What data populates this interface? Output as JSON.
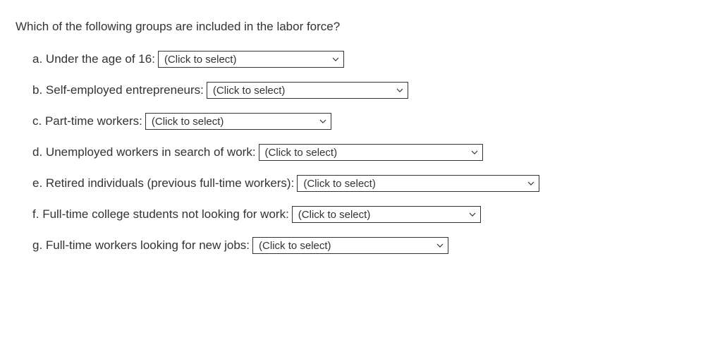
{
  "question": "Which of the following groups are included in the labor force?",
  "placeholder": "(Click to select)",
  "options": {
    "a": {
      "letter": "a.",
      "text": "Under the age of 16:"
    },
    "b": {
      "letter": "b.",
      "text": "Self-employed entrepreneurs:"
    },
    "c": {
      "letter": "c.",
      "text": "Part-time workers:"
    },
    "d": {
      "letter": "d.",
      "text": "Unemployed workers in search of work:"
    },
    "e": {
      "letter": "e.",
      "text": "Retired individuals (previous full-time workers):"
    },
    "f": {
      "letter": "f.",
      "text": "Full-time college students not looking for work:"
    },
    "g": {
      "letter": "g.",
      "text": "Full-time workers looking for new jobs:"
    }
  }
}
